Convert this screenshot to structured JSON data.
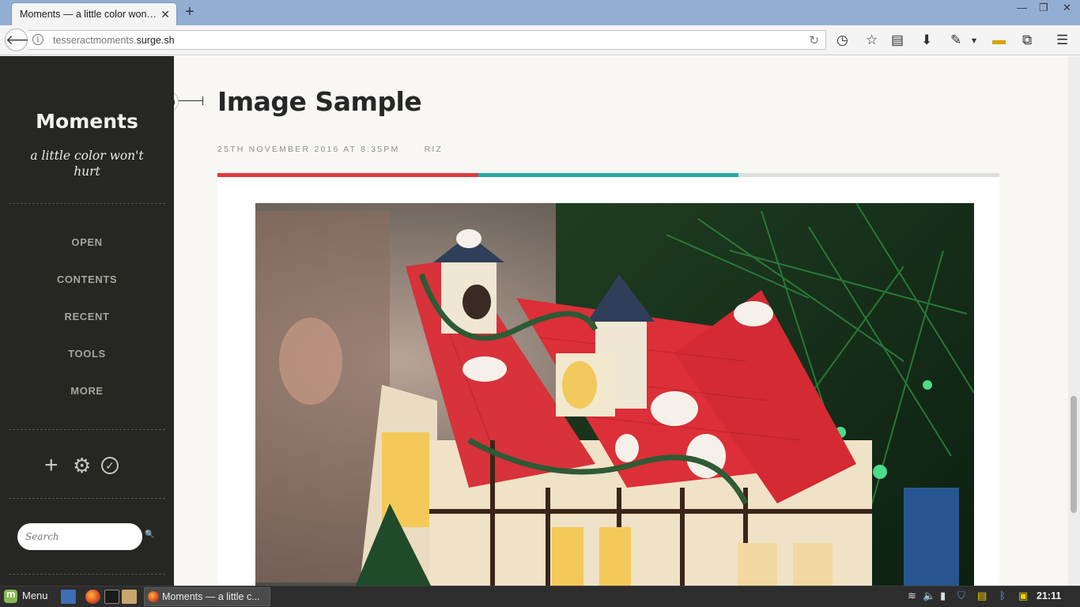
{
  "browser": {
    "tab_title": "Moments — a little color won…",
    "tab_close": "✕",
    "new_tab": "+",
    "url_host_prefix": "tesseractmoments.",
    "url_host_domain": "surge.sh",
    "window_controls": [
      "—",
      "❐",
      "✕"
    ],
    "toolbar_icons": [
      "history-icon",
      "star-icon",
      "reader-icon",
      "download-icon",
      "eyedropper-icon",
      "ruler-icon",
      "extension-icon",
      "hamburger-menu-icon"
    ]
  },
  "sidebar": {
    "brand": "Moments",
    "tagline": "a little color won't hurt",
    "menu": [
      {
        "label": "OPEN"
      },
      {
        "label": "CONTENTS"
      },
      {
        "label": "RECENT"
      },
      {
        "label": "TOOLS"
      },
      {
        "label": "MORE"
      }
    ],
    "actions": [
      {
        "icon": "plus-icon",
        "glyph": "+"
      },
      {
        "icon": "gear-icon",
        "glyph": "⚙"
      },
      {
        "icon": "check-circle-icon",
        "glyph": "✓"
      }
    ],
    "search": {
      "placeholder": "Search",
      "button_glyph": "🔍"
    }
  },
  "post": {
    "title": "Image Sample",
    "date": "25TH NOVEMBER 2016 AT 8:35PM",
    "author": "RIZ",
    "colorbar": [
      "#e03a3e",
      "#27a9a3",
      "#dedede"
    ],
    "image_alt": "Miniature Christmas house with red roof in front of a green tree"
  },
  "taskbar": {
    "menu_label": "Menu",
    "task_label": "Moments — a little c...",
    "clock": "21:11"
  }
}
